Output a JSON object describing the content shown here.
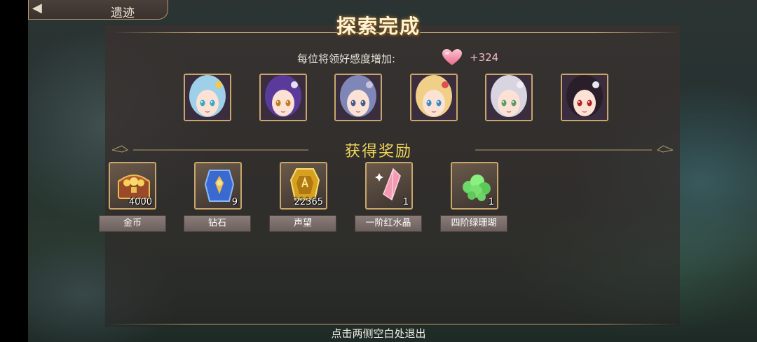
{
  "nav": {
    "back_arrow": "◀",
    "title": "遗迹"
  },
  "header": {
    "title": "探索完成"
  },
  "affection": {
    "label": "每位将领好感度增加:",
    "value": "+324",
    "icon": "heart-icon"
  },
  "portraits": [
    {
      "name": "portrait-1",
      "hair": "#9fd0ea",
      "eyes": "#3aa6c8",
      "accent": "#f2c94c"
    },
    {
      "name": "portrait-2",
      "hair": "#5a3a9a",
      "eyes": "#c07a20",
      "accent": "#e6e0f0"
    },
    {
      "name": "portrait-3",
      "hair": "#7f86b8",
      "eyes": "#4a5a8a",
      "accent": "#c8c4dc"
    },
    {
      "name": "portrait-4",
      "hair": "#f0d088",
      "eyes": "#3a8ac8",
      "accent": "#e05050"
    },
    {
      "name": "portrait-5",
      "hair": "#d8d4e0",
      "eyes": "#5a9a6a",
      "accent": "#f0eef4"
    },
    {
      "name": "portrait-6",
      "hair": "#2a1e2a",
      "eyes": "#b02020",
      "accent": "#e8e8f0"
    }
  ],
  "rewards_section": {
    "title": "获得奖励"
  },
  "rewards": [
    {
      "label": "金币",
      "count": "4000",
      "icon": "treasure-chest-icon"
    },
    {
      "label": "钻石",
      "count": "9",
      "icon": "diamond-crest-icon"
    },
    {
      "label": "声望",
      "count": "22365",
      "icon": "reputation-medal-icon"
    },
    {
      "label": "一阶红水晶",
      "count": "1",
      "icon": "red-crystal-icon"
    },
    {
      "label": "四阶绿珊瑚",
      "count": "1",
      "icon": "green-coral-icon"
    }
  ],
  "footer": {
    "hint": "点击两侧空白处退出"
  },
  "colors": {
    "gold_border": "#c9a66b",
    "section_title": "#f0d65a",
    "affection_value": "#f2b8c4"
  }
}
